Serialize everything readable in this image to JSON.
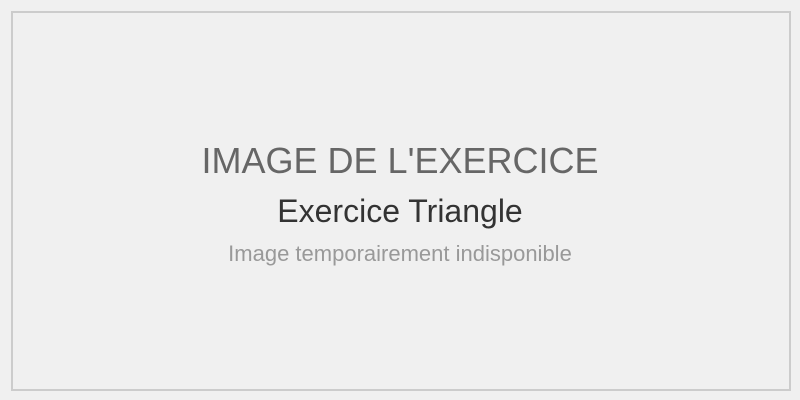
{
  "placeholder": {
    "heading": "IMAGE DE L'EXERCICE",
    "title": "Exercice Triangle",
    "subtitle": "Image temporairement indisponible"
  },
  "colors": {
    "background": "#f0f0f0",
    "border": "#cccccc",
    "heading": "#666666",
    "title": "#333333",
    "subtitle": "#999999"
  }
}
